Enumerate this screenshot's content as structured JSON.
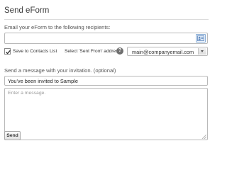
{
  "dialog": {
    "title": "Send eForm"
  },
  "recipients": {
    "label": "Email your eForm to the following recipients:",
    "value": "",
    "address_book_icon": "address-book-icon"
  },
  "options": {
    "save_to_contacts_label": "Save to Contacts List",
    "save_to_contacts_checked": true,
    "sent_from_label": "Select 'Sent From' address:",
    "info_icon": "info-icon",
    "info_glyph": "?",
    "sent_from_value": "main@companyemail.com"
  },
  "message": {
    "label": "Send a message with your invitation. (optional)",
    "subject_value": "You've been invited to Sample",
    "body_placeholder": "Enter a message."
  },
  "actions": {
    "send_label": "Send"
  }
}
